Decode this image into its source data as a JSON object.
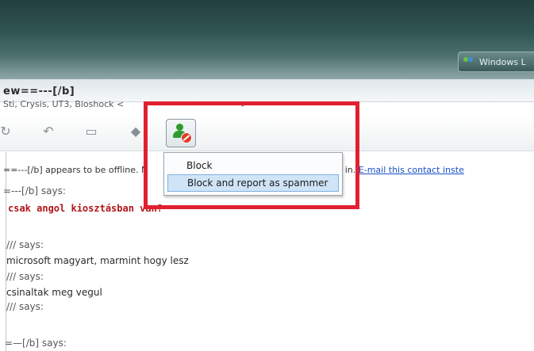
{
  "taskbar": {
    "label": "Windows L"
  },
  "contact": {
    "name": "ew==---[/b]",
    "status": "Sti, Crysis, UT3, Bioshock <",
    "arrow": ">"
  },
  "menu": {
    "items": [
      "Block",
      "Block and report as spammer"
    ]
  },
  "conversation": {
    "offline_notice_a": "==---[/b] appears to be offline. N",
    "offline_notice_b": "hen they sign in.",
    "offline_link": "E-mail this contact inste",
    "line1": "=---[/b] says:",
    "line2": "csak angol kiosztásban van?",
    "line3": "/// says:",
    "line4": "microsoft magyart, marmint hogy lesz",
    "line5": "/// says:",
    "line6": "csinaltak meg vegul",
    "line7": "/// says:",
    "line8": "=—[/b] says:"
  },
  "colors": {
    "highlight": "#e02030",
    "menu_selection": "#cfe4f7",
    "message_red": "#b0161a",
    "link": "#1a4fc7"
  }
}
